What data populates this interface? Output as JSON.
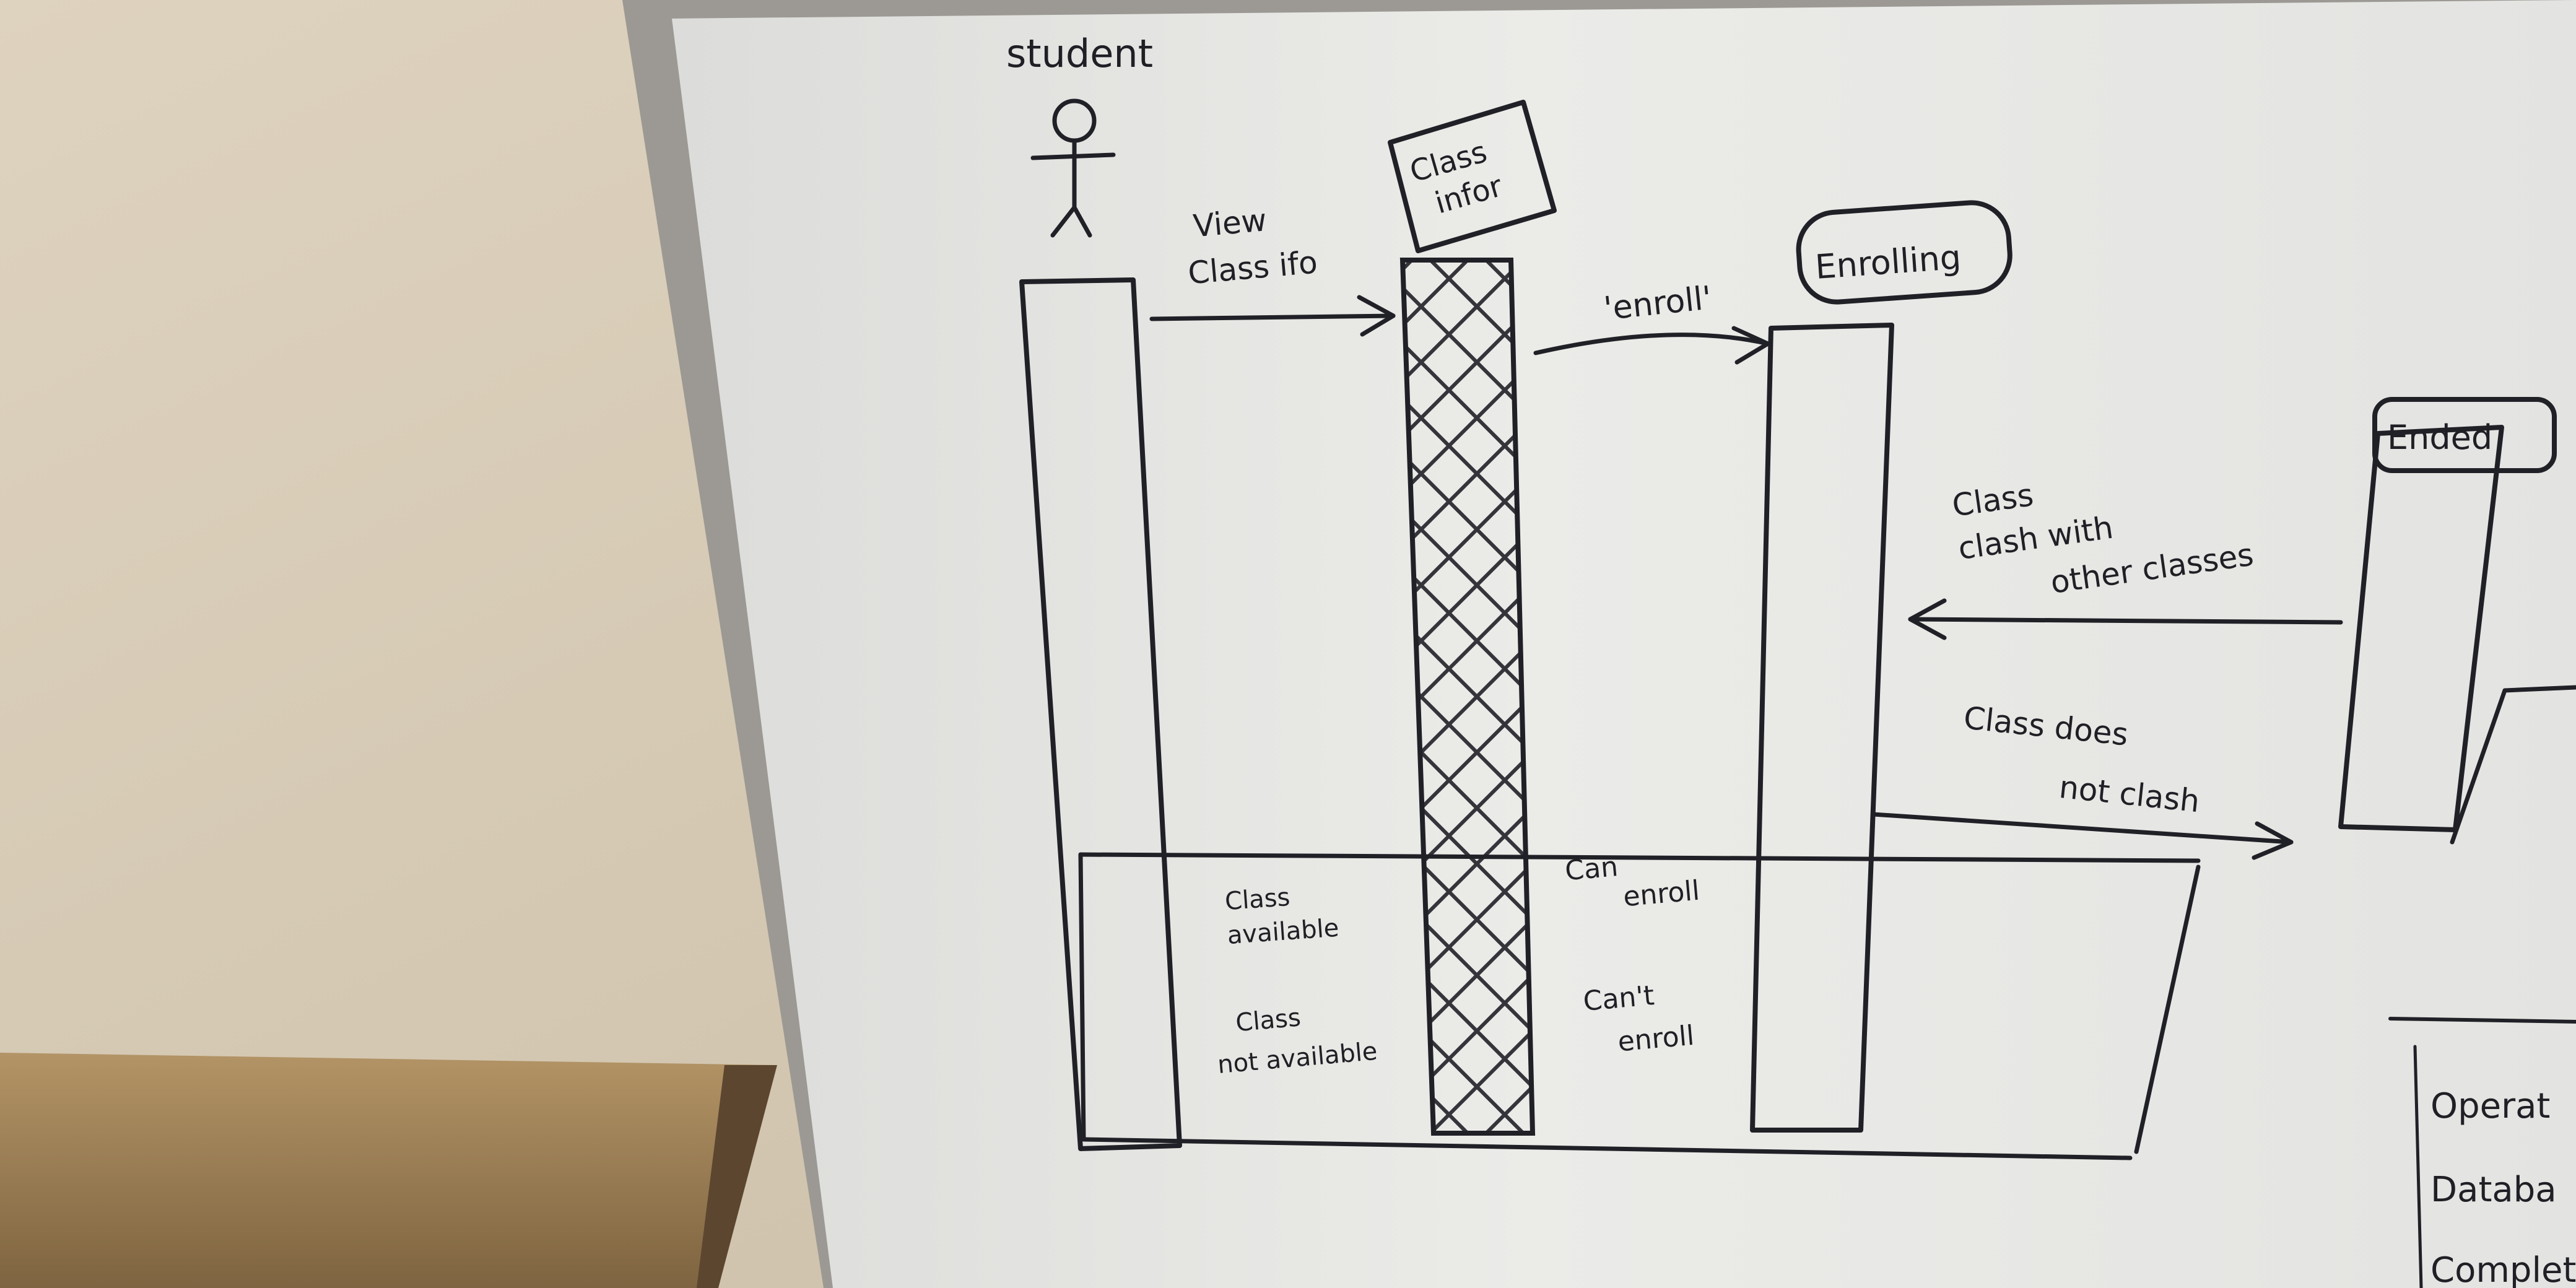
{
  "diagram": {
    "actor": {
      "label": "student"
    },
    "lifelines": {
      "class_info": {
        "label": "Class\ninfor"
      },
      "enrolling": {
        "label": "Enrolling"
      },
      "ended": {
        "label": "Ended"
      }
    },
    "messages": {
      "view_class_info": "View\nClass ifo",
      "enroll": "'enroll'",
      "class_clash": "Class\nclash with\nother classes",
      "class_no_clash": "Class does\nnot clash"
    },
    "notes": {
      "class_available": "Class\navailable",
      "class_not_available": "Class\nnot available",
      "can_enroll": "Can\nenroll",
      "cant_enroll": "Can't\nenroll"
    },
    "edge_fragments": [
      "Operat",
      "Databa",
      "Complet"
    ]
  },
  "colors": {
    "wall": "#d8cdb8",
    "board": "#e7e7e4",
    "frame": "#9c9994",
    "marker": "#202027",
    "desk": "#a98a5c"
  }
}
